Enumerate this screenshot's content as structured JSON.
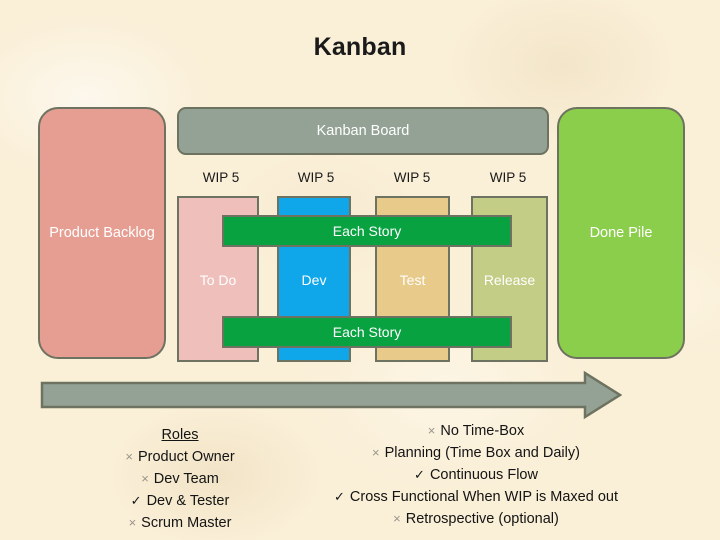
{
  "slide": {
    "title": "Kanban",
    "background_color": "#faefd7"
  },
  "board": {
    "header_label": "Kanban Board",
    "header_color": "#93a294",
    "backlog": {
      "label": "Product Backlog",
      "color": "#e79e92"
    },
    "done_pile": {
      "label": "Done Pile",
      "color": "#8bce4b"
    },
    "wip_labels": [
      "WIP 5",
      "WIP 5",
      "WIP 5",
      "WIP 5"
    ],
    "columns": [
      {
        "label": "To Do",
        "color": "#eebfbb"
      },
      {
        "label": "Dev",
        "color": "#0fa6ea"
      },
      {
        "label": "Test",
        "color": "#e8ca8a"
      },
      {
        "label": "Release",
        "color": "#c3cd86"
      }
    ],
    "story_bars": [
      {
        "label": "Each Story",
        "color": "#09a241"
      },
      {
        "label": "Each Story",
        "color": "#09a241"
      }
    ],
    "flow_arrow": {
      "name": "flow-arrow",
      "direction": "right",
      "color": "#93a294"
    }
  },
  "notes": {
    "roles": {
      "heading": "Roles",
      "items": [
        {
          "mark": "×",
          "mark_type": "x",
          "text": "Product Owner"
        },
        {
          "mark": "×",
          "mark_type": "x",
          "text": "Dev Team"
        },
        {
          "mark": "✓",
          "mark_type": "check",
          "text": "Dev & Tester"
        },
        {
          "mark": "×",
          "mark_type": "x",
          "text": "Scrum Master"
        }
      ]
    },
    "practices": {
      "items": [
        {
          "mark": "×",
          "mark_type": "x",
          "text": "No Time-Box"
        },
        {
          "mark": "×",
          "mark_type": "x",
          "text": "Planning (Time Box and Daily)"
        },
        {
          "mark": "✓",
          "mark_type": "check",
          "text": "Continuous Flow"
        },
        {
          "mark": "✓",
          "mark_type": "check",
          "text": "Cross Functional When WIP is Maxed out"
        },
        {
          "mark": "×",
          "mark_type": "x",
          "text": "Retrospective (optional)"
        }
      ]
    }
  }
}
